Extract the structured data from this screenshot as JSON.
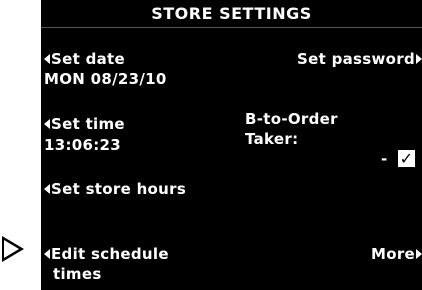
{
  "screen": {
    "title": "STORE SETTINGS",
    "set_date": {
      "label": "Set date",
      "value": "MON 08/23/10"
    },
    "set_time": {
      "label": "Set time",
      "value": "13:06:23"
    },
    "set_store_hours": {
      "label": "Set store hours"
    },
    "edit_schedule": {
      "label_line1": "Edit schedule",
      "label_line2": "times"
    },
    "set_password": {
      "label": "Set password"
    },
    "b_to_order": {
      "label_line1": "B-to-Order",
      "label_line2": "Taker:",
      "dash": "-",
      "checked": true,
      "check_glyph": "✓"
    },
    "more": {
      "label": "More"
    }
  },
  "icons": {
    "left_arrow": "left-triangle-icon",
    "right_arrow": "right-triangle-icon",
    "pointer": "pointer-arrow-icon"
  },
  "colors": {
    "screen_bg": "#000000",
    "text": "#ffffff",
    "page_bg": "#ffffff"
  }
}
